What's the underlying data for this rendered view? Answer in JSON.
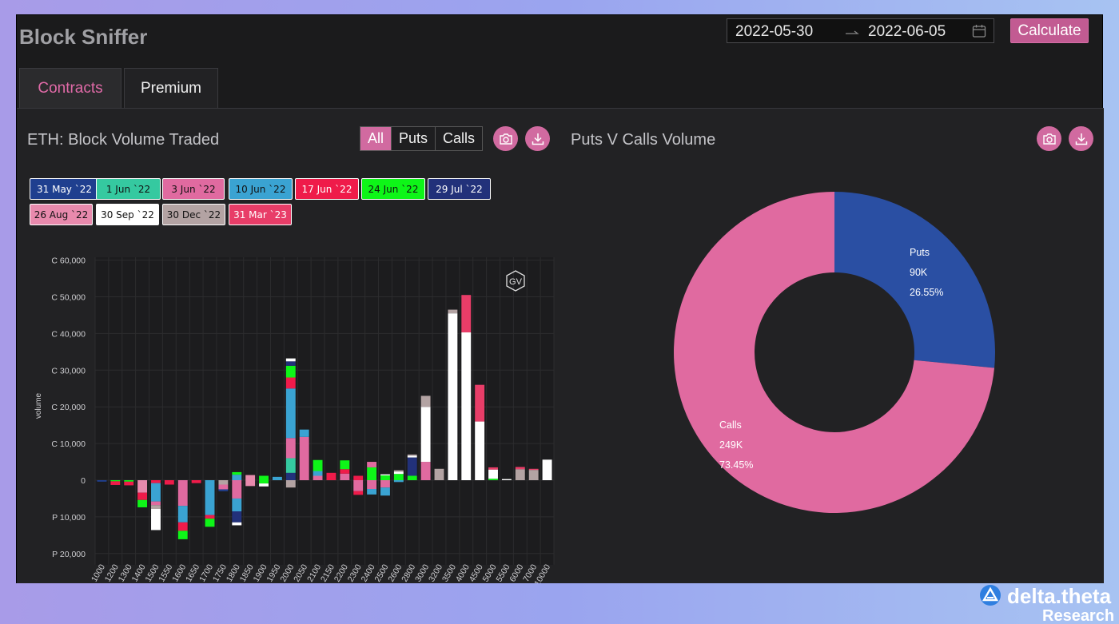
{
  "app": {
    "title": "Block Sniffer"
  },
  "date_range": {
    "start": "2022-05-30",
    "end": "2022-06-05",
    "separator": "→"
  },
  "calculate_label": "Calculate",
  "tabs": [
    {
      "label": "Contracts",
      "active": true
    },
    {
      "label": "Premium",
      "active": false
    }
  ],
  "left_panel": {
    "title": "ETH: Block Volume Traded",
    "filters": [
      {
        "label": "All",
        "selected": true
      },
      {
        "label": "Puts",
        "selected": false
      },
      {
        "label": "Calls",
        "selected": false
      }
    ],
    "legend": [
      {
        "label": "31 May `22",
        "color": "#1f3f8f",
        "text": "#ffffff"
      },
      {
        "label": "1 Jun `22",
        "color": "#35c9a0",
        "text": "#111111"
      },
      {
        "label": "3 Jun `22",
        "color": "#e06aa0",
        "text": "#111111"
      },
      {
        "label": "10 Jun `22",
        "color": "#3aa3d2",
        "text": "#111111"
      },
      {
        "label": "17 Jun `22",
        "color": "#ef1b4a",
        "text": "#ffffff"
      },
      {
        "label": "24 Jun `22",
        "color": "#0ef518",
        "text": "#111111"
      },
      {
        "label": "29 Jul `22",
        "color": "#22317a",
        "text": "#ffffff"
      },
      {
        "label": "26 Aug `22",
        "color": "#e88aad",
        "text": "#111111"
      },
      {
        "label": "30 Sep `22",
        "color": "#ffffff",
        "text": "#111111"
      },
      {
        "label": "30 Dec `22",
        "color": "#b3a3a3",
        "text": "#111111"
      },
      {
        "label": "31 Mar `23",
        "color": "#e83d68",
        "text": "#ffffff"
      }
    ],
    "badge": "GV"
  },
  "chart_data": [
    {
      "type": "bar",
      "stacked": true,
      "ylabel": "volume",
      "y_ticks": [
        "C 60,000",
        "C 50,000",
        "C 40,000",
        "C 30,000",
        "C 20,000",
        "C 10,000",
        "0",
        "P 10,000",
        "P 20,000"
      ],
      "ylim": [
        -20000,
        60000
      ],
      "note": "positive = calls, negative = puts",
      "categories": [
        "1000",
        "1200",
        "1300",
        "1400",
        "1500",
        "1550",
        "1600",
        "1650",
        "1700",
        "1750",
        "1800",
        "1850",
        "1900",
        "1950",
        "2000",
        "2050",
        "2100",
        "2150",
        "2200",
        "2300",
        "2400",
        "2500",
        "2600",
        "2800",
        "3000",
        "3200",
        "3500",
        "4000",
        "4500",
        "5000",
        "5500",
        "6000",
        "7000",
        "10000"
      ],
      "stacks": [
        [
          [
            "#1f3f8f",
            -400
          ]
        ],
        [
          [
            "#0ef518",
            -300
          ],
          [
            "#ef1b4a",
            -1000
          ]
        ],
        [
          [
            "#0ef518",
            -400
          ],
          [
            "#ef1b4a",
            -1000
          ]
        ],
        [
          [
            "#e88aad",
            -3400
          ],
          [
            "#ef1b4a",
            -2000
          ],
          [
            "#0ef518",
            -2000
          ]
        ],
        [
          [
            "#ef1b4a",
            -800
          ],
          [
            "#3aa3d2",
            -5000
          ],
          [
            "#e06aa0",
            -1000
          ],
          [
            "#b3a3a3",
            -1000
          ],
          [
            "#ffffff",
            -5800
          ]
        ],
        [
          [
            "#ef1b4a",
            -1200
          ]
        ],
        [
          [
            "#e06aa0",
            -7000
          ],
          [
            "#3aa3d2",
            -4500
          ],
          [
            "#ef1b4a",
            -2300
          ],
          [
            "#0ef518",
            -2300
          ]
        ],
        [
          [
            "#ef1b4a",
            -800
          ]
        ],
        [
          [
            "#3aa3d2",
            -9500
          ],
          [
            "#ef1b4a",
            -1000
          ],
          [
            "#0ef518",
            -2200
          ]
        ],
        [
          [
            "#b3a3a3",
            -1200
          ],
          [
            "#e06aa0",
            -1300
          ],
          [
            "#1f3f8f",
            -500
          ]
        ],
        [
          [
            "#e06aa0",
            -5000
          ],
          [
            "#3aa3d2",
            -3500
          ],
          [
            "#22317a",
            -3000
          ],
          [
            "#ffffff",
            -800
          ],
          [
            "#3aa3d2",
            1500
          ],
          [
            "#0ef518",
            700
          ]
        ],
        [
          [
            "#e88aad",
            -1600
          ],
          [
            "#e88aad",
            1400
          ]
        ],
        [
          [
            "#0ef518",
            -900
          ],
          [
            "#ffffff",
            -800
          ],
          [
            "#0ef518",
            1200
          ]
        ],
        [
          [
            "#3aa3d2",
            900
          ]
        ],
        [
          [
            "#b3a3a3",
            -2000
          ],
          [
            "#22317a",
            2000
          ],
          [
            "#35c9a0",
            4000
          ],
          [
            "#e06aa0",
            5500
          ],
          [
            "#3aa3d2",
            13500
          ],
          [
            "#ef1b4a",
            3000
          ],
          [
            "#0ef518",
            3200
          ],
          [
            "#22317a",
            1200
          ],
          [
            "#ffffff",
            800
          ]
        ],
        [
          [
            "#e06aa0",
            11800
          ],
          [
            "#3aa3d2",
            2000
          ]
        ],
        [
          [
            "#e06aa0",
            1200
          ],
          [
            "#3aa3d2",
            1300
          ],
          [
            "#0ef518",
            3000
          ]
        ],
        [
          [
            "#ef1b4a",
            2000
          ]
        ],
        [
          [
            "#e06aa0",
            1800
          ],
          [
            "#ef1b4a",
            1200
          ],
          [
            "#0ef518",
            2400
          ]
        ],
        [
          [
            "#e06aa0",
            -3000
          ],
          [
            "#ef1b4a",
            -1000
          ],
          [
            "#ef1b4a",
            1200
          ]
        ],
        [
          [
            "#e06aa0",
            -2400
          ],
          [
            "#3aa3d2",
            -1500
          ],
          [
            "#0ef518",
            3500
          ],
          [
            "#e06aa0",
            1500
          ]
        ],
        [
          [
            "#e06aa0",
            -2000
          ],
          [
            "#3aa3d2",
            -2200
          ],
          [
            "#0ef518",
            1300
          ],
          [
            "#ffffff",
            300
          ]
        ],
        [
          [
            "#3aa3d2",
            -500
          ],
          [
            "#0ef518",
            1700
          ],
          [
            "#ffffff",
            600
          ],
          [
            "#b3a3a3",
            400
          ]
        ],
        [
          [
            "#0ef518",
            1200
          ],
          [
            "#22317a",
            5000
          ],
          [
            "#ffffff",
            500
          ],
          [
            "#b3a3a3",
            300
          ]
        ],
        [
          [
            "#e06aa0",
            5000
          ],
          [
            "#ffffff",
            15000
          ],
          [
            "#b3a3a3",
            3000
          ]
        ],
        [
          [
            "#b3a3a3",
            3100
          ]
        ],
        [
          [
            "#ffffff",
            45500
          ],
          [
            "#b3a3a3",
            1000
          ]
        ],
        [
          [
            "#ffffff",
            40300
          ],
          [
            "#e83d68",
            10200
          ]
        ],
        [
          [
            "#ffffff",
            16000
          ],
          [
            "#e83d68",
            10000
          ]
        ],
        [
          [
            "#0ef518",
            400
          ],
          [
            "#ffffff",
            2500
          ],
          [
            "#e83d68",
            600
          ]
        ],
        [
          [
            "#ffffff",
            300
          ]
        ],
        [
          [
            "#b3a3a3",
            3000
          ],
          [
            "#e83d68",
            600
          ]
        ],
        [
          [
            "#b3a3a3",
            2800
          ],
          [
            "#e83d68",
            300
          ]
        ],
        [
          [
            "#ffffff",
            5600
          ]
        ]
      ]
    },
    {
      "type": "pie",
      "title": "Puts V Calls Volume",
      "slices": [
        {
          "label": "Puts",
          "value": "90K",
          "value_num": 90000,
          "percent": "26.55%",
          "percent_num": 26.55,
          "color": "#2a4fa3"
        },
        {
          "label": "Calls",
          "value": "249K",
          "value_num": 249000,
          "percent": "73.45%",
          "percent_num": 73.45,
          "color": "#e06aa0"
        }
      ]
    }
  ],
  "right_panel": {
    "title": "Puts V Calls Volume"
  },
  "brand": {
    "name": "delta.theta",
    "sub": "Research"
  }
}
